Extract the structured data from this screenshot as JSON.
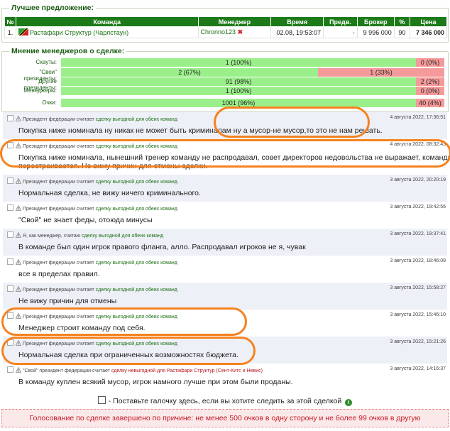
{
  "best_offer": {
    "legend": "Лучшее предложение:",
    "columns": [
      "№",
      "Команда",
      "Менеджер",
      "Время",
      "Предв.",
      "Брокер",
      "%",
      "Цена"
    ],
    "row": {
      "num": "1.",
      "team": "Растафари Структур (Чарлстаун)",
      "manager": "Chronno123",
      "manager_mark": "✖",
      "time": "02.08, 19:53:07",
      "prev": "-",
      "broker": "9 996 000",
      "pct": "90",
      "price": "7 346 000"
    }
  },
  "opinion": {
    "legend": "Мнение менеджеров о сделке:",
    "rows": [
      {
        "label": "Скауты:",
        "yes": "1 (100%)",
        "no": "0 (0%)",
        "yes_pct": 100
      },
      {
        "label": "\"Свои\" президенты:",
        "yes": "2 (67%)",
        "no": "1 (33%)",
        "yes_pct": 67
      },
      {
        "label": "Другие президенты:",
        "yes": "91 (98%)",
        "no": "2 (2%)",
        "yes_pct": 98
      },
      {
        "label": "Менеджеры:",
        "yes": "1 (100%)",
        "no": "0 (0%)",
        "yes_pct": 100
      },
      {
        "label": "Очки:",
        "yes": "1001 (96%)",
        "no": "40 (4%)",
        "yes_pct": 96
      }
    ]
  },
  "comments": [
    {
      "prefix": "Президент федерации считает",
      "link": "сделку выгодной для обеих команд",
      "suffix": "",
      "date": "4 августа 2022, 17:36:51",
      "text": "Покупка ниже номинала ну никак не может быть криминалам ну а мусор-не мусор,то это не нам решать."
    },
    {
      "prefix": "Президент федерации считает",
      "link": "сделку выгодной для обеих команд",
      "suffix": "",
      "date": "4 августа 2022, 08:32:43",
      "text": "Покупка ниже номинала, нынешний тренер команду не распродавал, совет директоров недовольства не выражает, команда",
      "text2": "перестраивается. Не вижу причин для отмены сделки."
    },
    {
      "prefix": "Президент федерации считает",
      "link": "сделку выгодной для обеих команд",
      "suffix": "",
      "date": "3 августа 2022, 20:20:19",
      "text": "Нормальная сделка, не вижу ничего криминального."
    },
    {
      "prefix": "Президент федерации считает",
      "link": "сделку выгодной для обеих команд",
      "suffix": "",
      "date": "3 августа 2022, 19:42:56",
      "text": "\"Свой\" не знает феды, отоюда минусы"
    },
    {
      "prefix": "Я, как менеджер, считаю",
      "link": "сделку выгодной для обеих команд",
      "suffix": "",
      "date": "3 августа 2022, 19:37:41",
      "text": "В команде был один игрок правого фланга, алло. Распродавал игроков не я, чувак"
    },
    {
      "prefix": "Президент федерации считает",
      "link": "сделку выгодной для обеих команд",
      "suffix": "",
      "date": "3 августа 2022, 18:46:09",
      "text": "все в пределах правил."
    },
    {
      "prefix": "Президент федерации считает",
      "link": "сделку выгодной для обеих команд",
      "suffix": "",
      "date": "3 августа 2022, 15:58:27",
      "text": "Не вижу причин для отмены"
    },
    {
      "prefix": "Президент федерации считает",
      "link": "сделку выгодной для обеих команд",
      "suffix": "",
      "date": "3 августа 2022, 15:46:10",
      "text": "Менеджер строит команду под себя."
    },
    {
      "prefix": "Президент федерации считает",
      "link": "сделку выгодной для обеих команд",
      "suffix": "",
      "date": "3 августа 2022, 15:21:26",
      "text": "Нормальная сделка при ограниченных возможностях бюджета."
    },
    {
      "prefix": "\"Свой\" президент федерации считает",
      "link": "сделку невыгодной для Растафари Структур (Сент-Китс и Невис)",
      "suffix": "",
      "date": "3 августа 2022, 14:16:37",
      "text": "В команду куплен всякий мусор, игрок намного лучше при этом были проданы.",
      "negative": true
    }
  ],
  "follow_text": "- Поставьте галочку здесь, если вы хотите следить за этой сделкой",
  "closed_text": "Голосование по сделке завершено по причине: не менее 500 очков в одну сторону и не более 99 очков в другую",
  "colors": {
    "header_green": "#1c7a18",
    "yes_bar": "#9bef8a",
    "no_bar": "#f59a9a",
    "annotation": "#f5821f"
  }
}
